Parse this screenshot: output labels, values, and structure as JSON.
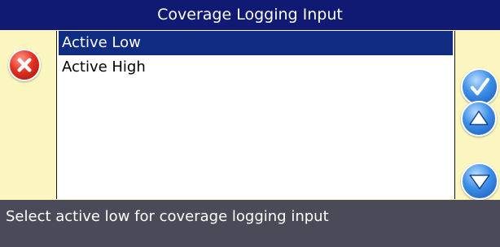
{
  "dialog": {
    "title": "Coverage Logging Input"
  },
  "options": {
    "items": [
      {
        "label": "Active Low",
        "selected": true
      },
      {
        "label": "Active High",
        "selected": false
      }
    ]
  },
  "status": {
    "message": "Select active low for coverage logging input"
  },
  "icons": {
    "cancel": "close-x-icon",
    "ok": "checkmark-icon",
    "up": "triangle-up-icon",
    "down": "triangle-down-icon"
  },
  "colors": {
    "title_bar": "#101a72",
    "selection": "#0f2b82",
    "panel": "#fbf6bf",
    "status_bar": "#4a4a58",
    "cancel_button": "#e23324",
    "nav_button": "#3d8ee6"
  }
}
